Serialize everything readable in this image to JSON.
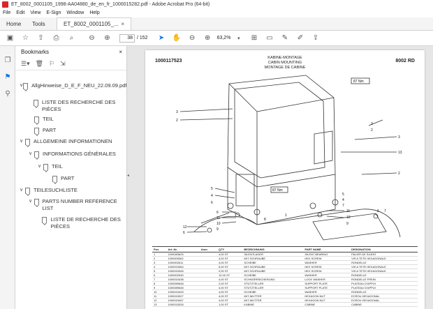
{
  "window": {
    "title": "ET_8002_0001105_1998-AA04880_de_en_fr_1000015282.pdf - Adobe Acrobat Pro (64-bit)"
  },
  "menu": [
    "File",
    "Edit",
    "View",
    "E-Sign",
    "Window",
    "Help"
  ],
  "tabs": {
    "home": "Home",
    "tools": "Tools",
    "doc": "ET_8002_0001105_...",
    "close": "×"
  },
  "toolbar": {
    "page_current": "38",
    "page_total": "/ 152",
    "zoom": "63,2%"
  },
  "bookmarks": {
    "title": "Bookmarks",
    "items": [
      {
        "label": "AllgHinweise_D_E_F_NEU_22.09.09.pdf",
        "chev": "∨"
      },
      {
        "label": "LISTE DES RECHERCHE DES PIÈCES",
        "chev": ""
      },
      {
        "label": "TEIL",
        "chev": ""
      },
      {
        "label": "PART",
        "chev": ""
      },
      {
        "label": "ALLGEMEINE INFORMATIONEN",
        "chev": "∨"
      },
      {
        "label": "INFORMATIONS GÉNÉRALES",
        "chev": "∨"
      },
      {
        "label": "TEIL",
        "chev": "∨"
      },
      {
        "label": "PART",
        "chev": ""
      },
      {
        "label": "TEILESUCHLISTE",
        "chev": "∨"
      },
      {
        "label": "PARTS NUMBER REFERENCE LIST",
        "chev": "∨"
      },
      {
        "label": "LISTE DE RECHERCHE DES PIÈCES",
        "chev": ""
      }
    ]
  },
  "pdf": {
    "part_number": "1000117523",
    "model": "8002 RD",
    "titles": [
      "KABINE-MONTAGE",
      "CABIN MOUNTING",
      "MONTAGE DE CABINE"
    ],
    "callouts": {
      "torque": "87 Nm",
      "torque2": "87 Nm",
      "labels": [
        "3",
        "2",
        "3",
        "2",
        "3",
        "2",
        "5",
        "4",
        "6",
        "5",
        "4",
        "7",
        "8",
        "1",
        "13",
        "6",
        "12",
        "11",
        "10",
        "9",
        "11",
        "10",
        "9",
        "6",
        "6",
        "7"
      ]
    },
    "table": {
      "headers": [
        "Pos",
        "Art.-Nr.",
        "Anm.",
        "QTY",
        "BEZEICHNUNG",
        "PART NAME",
        "DESIGNATION"
      ],
      "rows": [
        [
          "1",
          "1000083625",
          "",
          "4,00 ST",
          "SILENTLAGER",
          "SILENT BEARING",
          "PALIER DE SILENT"
        ],
        [
          "2",
          "1000005362",
          "",
          "4,00 ST",
          "6KT-SCHRAUBE",
          "HEX SCREW",
          "VIS A TETE HEXAGONALE"
        ],
        [
          "3",
          "1000002611",
          "",
          "4,00 ST",
          "SCHEIBE",
          "WASHER",
          "RONDELLE"
        ],
        [
          "4",
          "1000015364",
          "",
          "5,00 ST",
          "6KT-SCHRAUBE",
          "HEX SCREW",
          "VIS A TETE HEXAGONALE"
        ],
        [
          "5",
          "1000015345",
          "",
          "2,00 ST",
          "6KT-SCHRAUBE",
          "HEX SCREW",
          "VIS A TETE HEXAGONALE"
        ],
        [
          "6",
          "1000002530",
          "",
          "12,00 ST",
          "SCHEIBE",
          "WASHER",
          "RONDELLE"
        ],
        [
          "7",
          "1000015438",
          "",
          "4,00 ST",
          "SCHNORRSICHERUNG",
          "LOCK WASHER",
          "RONDELLE FREIN"
        ],
        [
          "8",
          "1000089648",
          "",
          "2,00 ST",
          "STÜTZTELLER",
          "SUPPORT PLATE",
          "PLATEAU D'APPUI"
        ],
        [
          "9",
          "1000089648",
          "",
          "4,00 ST",
          "STÜTZTELLER",
          "SUPPORT PLATE",
          "PLATEAU D'APPUI"
        ],
        [
          "10",
          "1000015433",
          "",
          "4,00 ST",
          "SCHEIBE",
          "WASHER",
          "RONDELLE"
        ],
        [
          "11",
          "1000015327",
          "",
          "4,00 ST",
          "6KT-MUTTER",
          "HEXAGON NUT",
          "ECROU HEXAGONAL"
        ],
        [
          "12",
          "1000015467",
          "",
          "4,00 ST",
          "6KT-MUTTER",
          "HEXAGON NUT",
          "ECROU HEXAGONAL"
        ],
        [
          "13",
          "1000015326",
          "",
          "1,00 ST",
          "KABINE",
          "CABINE",
          "CABINE"
        ]
      ]
    }
  }
}
